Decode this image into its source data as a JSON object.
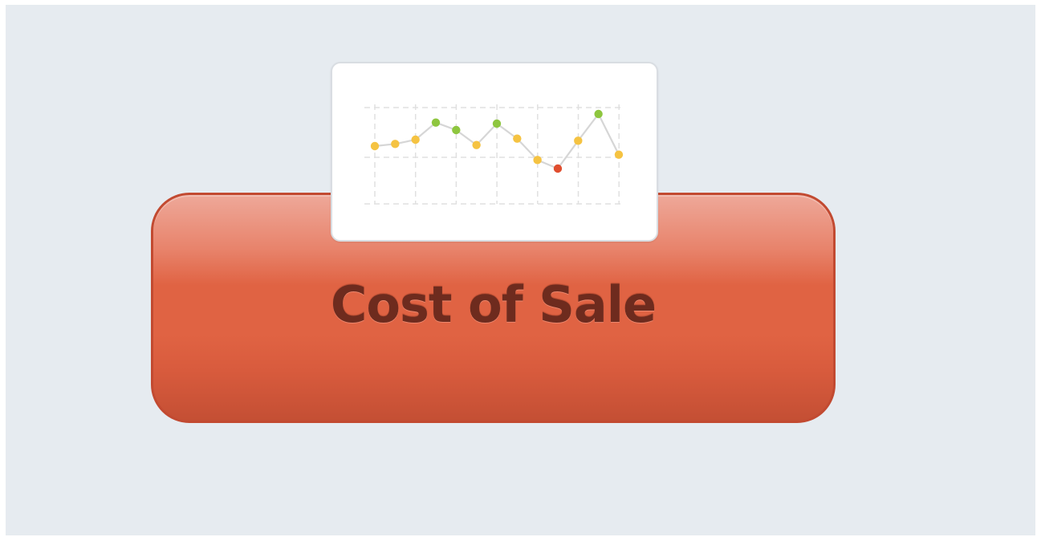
{
  "button": {
    "label": "Cost of Sale"
  },
  "chart_data": {
    "type": "line",
    "title": "",
    "xlabel": "",
    "ylabel": "",
    "x": [
      1,
      2,
      3,
      4,
      5,
      6,
      7,
      8,
      9,
      10,
      11,
      12,
      13
    ],
    "values": [
      5.4,
      5.6,
      6.0,
      7.6,
      6.9,
      5.5,
      7.5,
      6.1,
      4.1,
      3.3,
      5.9,
      8.4,
      4.6
    ],
    "point_status": [
      "neutral",
      "neutral",
      "neutral",
      "good",
      "good",
      "neutral",
      "good",
      "neutral",
      "neutral",
      "bad",
      "neutral",
      "good",
      "neutral"
    ],
    "ylim": [
      0,
      9
    ],
    "grid": true,
    "legend": "none"
  },
  "colors": {
    "neutral": "#f5c342",
    "good": "#8ec63f",
    "bad": "#e04e2f",
    "line": "#d6d6d6",
    "grid": "#e0e0e0",
    "button_border": "#c24a31",
    "button_text": "#6e2b1e",
    "background": "#e6ebf0"
  },
  "icons": {
    "chart": "line-chart-icon"
  }
}
